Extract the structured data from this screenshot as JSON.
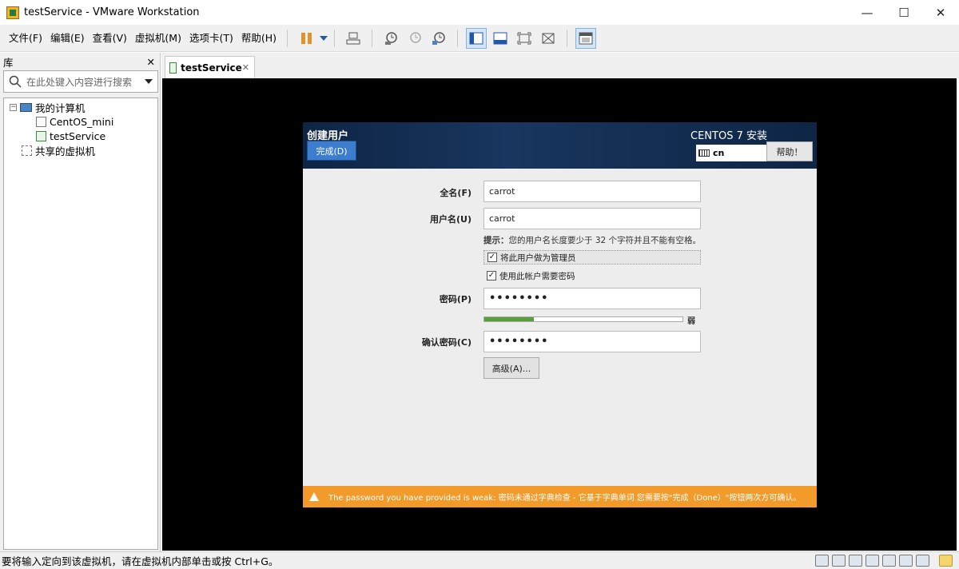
{
  "window": {
    "title": "testService - VMware Workstation",
    "controls": {
      "minimize": "—",
      "maximize": "☐",
      "close": "✕"
    }
  },
  "menu": [
    {
      "label": "文件(F)"
    },
    {
      "label": "编辑(E)"
    },
    {
      "label": "查看(V)"
    },
    {
      "label": "虚拟机(M)"
    },
    {
      "label": "选项卡(T)"
    },
    {
      "label": "帮助(H)"
    }
  ],
  "library": {
    "title": "库",
    "close": "✕",
    "search_placeholder": "在此处键入内容进行搜索",
    "tree": {
      "toggle": "−",
      "root": "我的计算机",
      "vms": [
        "CentOS_mini",
        "testService"
      ],
      "shared": "共享的虚拟机"
    }
  },
  "tab": {
    "label": "testService",
    "close": "✕"
  },
  "installer": {
    "title": "创建用户",
    "done_button": "完成(D)",
    "product": "CENTOS 7 安装",
    "keyboard": "cn",
    "help_button": "帮助！",
    "fullname_label": "全名(F)",
    "fullname_value": "carrot",
    "username_label": "用户名(U)",
    "username_value": "carrot",
    "hint_prefix": "提示：",
    "hint_text": "您的用户名长度要少于 32 个字符并且不能有空格。",
    "admin_checkbox": "将此用户做为管理员",
    "require_password_checkbox": "使用此帐户需要密码",
    "password_label": "密码(P)",
    "password_value": "••••••••",
    "strength_label": "弱",
    "strength_fraction": 0.25,
    "confirm_label": "确认密码(C)",
    "confirm_value": "••••••••",
    "advanced_button": "高级(A)...",
    "warning": "The password you have provided is weak: 密码未通过字典检查 - 它基于字典单词 您需要按\"完成（Done）\"按钮两次方可确认。"
  },
  "status": {
    "text": "要将输入定向到该虚拟机，请在虚拟机内部单击或按 Ctrl+G。"
  }
}
